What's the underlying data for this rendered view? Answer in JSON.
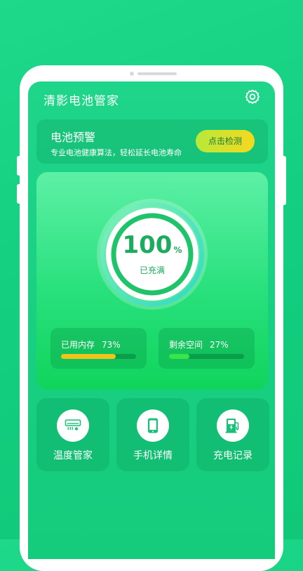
{
  "app": {
    "title": "清影电池管家"
  },
  "warning": {
    "title": "电池预警",
    "subtitle": "专业电池健康算法，轻松延长电池寿命",
    "button_label": "点击检测"
  },
  "battery": {
    "percent": "100",
    "unit": "%",
    "status": "已充满",
    "level": 1.0
  },
  "stats": {
    "memory": {
      "label": "已用内存",
      "value": "73%",
      "fraction": 0.73,
      "color": "#f2c318"
    },
    "storage": {
      "label": "剩余空间",
      "value": "27%",
      "fraction": 0.27,
      "color": "#39e64a"
    }
  },
  "features": [
    {
      "label": "温度管家",
      "icon": "air-conditioner-icon"
    },
    {
      "label": "手机详情",
      "icon": "phone-icon"
    },
    {
      "label": "充电记录",
      "icon": "charging-station-icon"
    }
  ],
  "colors": {
    "accent": "#1dab5f",
    "background": "#1ed98a"
  }
}
